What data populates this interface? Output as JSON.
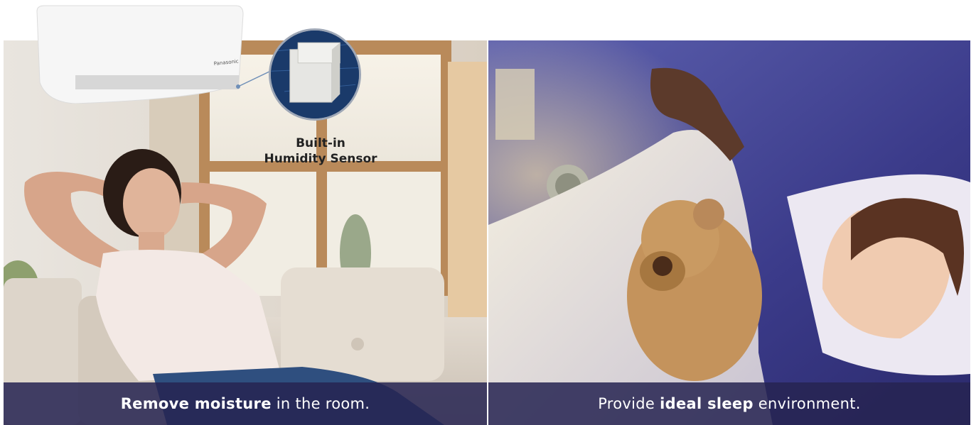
{
  "left_panel": {
    "caption_bold": "Remove moisture",
    "caption_rest": " in the room."
  },
  "right_panel": {
    "caption_pre": "Provide ",
    "caption_bold": "ideal sleep",
    "caption_rest": " environment."
  },
  "sensor": {
    "label_line1": "Built-in",
    "label_line2": "Humidity Sensor"
  },
  "ac_unit": {
    "brand_logo": "Panasonic"
  },
  "colors": {
    "caption_bar": "#262452",
    "sensor_ring": "#9ea7b6",
    "night_blue": "#3a3a8a"
  }
}
